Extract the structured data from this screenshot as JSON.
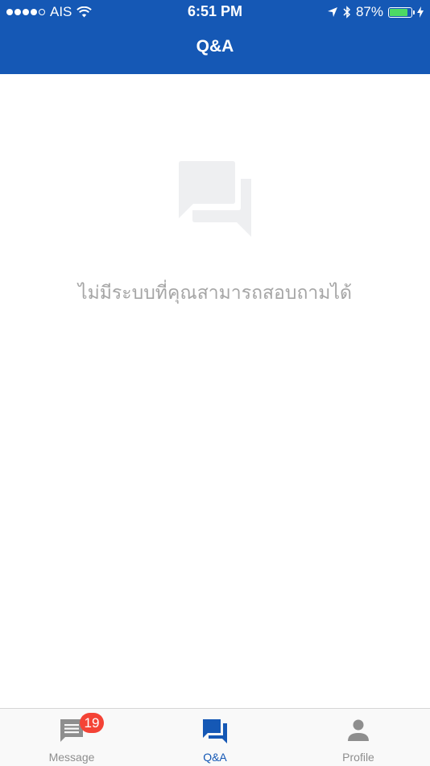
{
  "status_bar": {
    "carrier": "AIS",
    "time": "6:51 PM",
    "battery_percent": "87%",
    "battery_level": 0.87,
    "signal_bars": 4
  },
  "nav": {
    "title": "Q&A"
  },
  "empty_state": {
    "icon": "forum-icon",
    "message": "ไม่มีระบบที่คุณสามารถสอบถามได้"
  },
  "tabs": [
    {
      "label": "Message",
      "icon": "message-icon",
      "badge": "19",
      "active": false
    },
    {
      "label": "Q&A",
      "icon": "forum-icon",
      "active": true
    },
    {
      "label": "Profile",
      "icon": "person-icon",
      "active": false
    }
  ],
  "colors": {
    "brand": "#1558b5",
    "badge": "#f44336",
    "battery": "#4cd964",
    "inactive": "#8e8e8e"
  }
}
